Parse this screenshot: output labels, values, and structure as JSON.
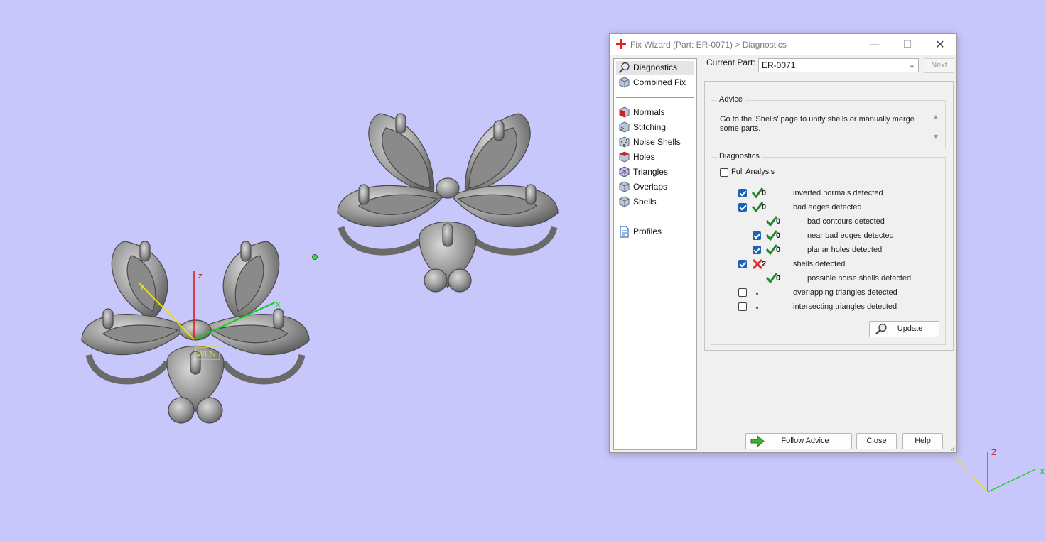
{
  "window": {
    "title": "Fix Wizard (Part: ER-0071) > Diagnostics",
    "minimize_icon": "minimize-icon",
    "maximize_icon": "maximize-icon",
    "close_icon": "close-icon"
  },
  "nav": {
    "items": [
      {
        "label": "Diagnostics",
        "icon": "magnifier-icon",
        "active": true
      },
      {
        "label": "Combined Fix",
        "icon": "cube-icon"
      },
      {
        "label": "Normals",
        "icon": "normals-cube-icon"
      },
      {
        "label": "Stitching",
        "icon": "stitching-cube-icon"
      },
      {
        "label": "Noise Shells",
        "icon": "noise-cube-icon"
      },
      {
        "label": "Holes",
        "icon": "holes-cube-icon"
      },
      {
        "label": "Triangles",
        "icon": "triangles-cube-icon"
      },
      {
        "label": "Overlaps",
        "icon": "overlaps-cube-icon"
      },
      {
        "label": "Shells",
        "icon": "shells-cube-icon"
      },
      {
        "label": "Profiles",
        "icon": "document-icon"
      }
    ]
  },
  "header": {
    "current_part_label": "Current Part:",
    "current_part_value": "ER-0071",
    "next_label": "Next"
  },
  "advice": {
    "title": "Advice",
    "text": "Go to the 'Shells' page to unify shells or manually merge some parts."
  },
  "diagnostics": {
    "title": "Diagnostics",
    "full_analysis_label": "Full Analysis",
    "full_analysis_checked": false,
    "rows": [
      {
        "checked": true,
        "has_checkbox": true,
        "status": "ok",
        "count": "0",
        "text": "inverted normals detected",
        "indent": 0
      },
      {
        "checked": true,
        "has_checkbox": true,
        "status": "ok",
        "count": "0",
        "text": "bad edges detected",
        "indent": 0
      },
      {
        "checked": false,
        "has_checkbox": false,
        "status": "ok",
        "count": "0",
        "text": "bad contours detected",
        "indent": 1
      },
      {
        "checked": true,
        "has_checkbox": true,
        "status": "ok",
        "count": "0",
        "text": "near bad edges detected",
        "indent": 1
      },
      {
        "checked": true,
        "has_checkbox": true,
        "status": "ok",
        "count": "0",
        "text": "planar holes detected",
        "indent": 1
      },
      {
        "checked": true,
        "has_checkbox": true,
        "status": "error",
        "count": "2",
        "text": "shells detected",
        "indent": 0
      },
      {
        "checked": false,
        "has_checkbox": false,
        "status": "ok",
        "count": "0",
        "text": "possible noise shells detected",
        "indent": 1
      },
      {
        "checked": false,
        "has_checkbox": true,
        "status": "none",
        "count": "",
        "text": "overlapping triangles detected",
        "indent": 0
      },
      {
        "checked": false,
        "has_checkbox": true,
        "status": "none",
        "count": "",
        "text": "intersecting triangles detected",
        "indent": 0
      }
    ],
    "update_label": "Update"
  },
  "footer": {
    "follow_advice_label": "Follow Advice",
    "close_label": "Close",
    "help_label": "Help"
  },
  "viewport": {
    "wcs_label": "WCS",
    "axis_x": "x",
    "axis_y": "y",
    "axis_z": "z",
    "corner_axis_x": "X",
    "corner_axis_z": "Z"
  },
  "colors": {
    "background": "#c7c7fb",
    "ok_green": "#1f8a2c",
    "error_red": "#d9302c",
    "check_blue": "#1a63b8"
  }
}
